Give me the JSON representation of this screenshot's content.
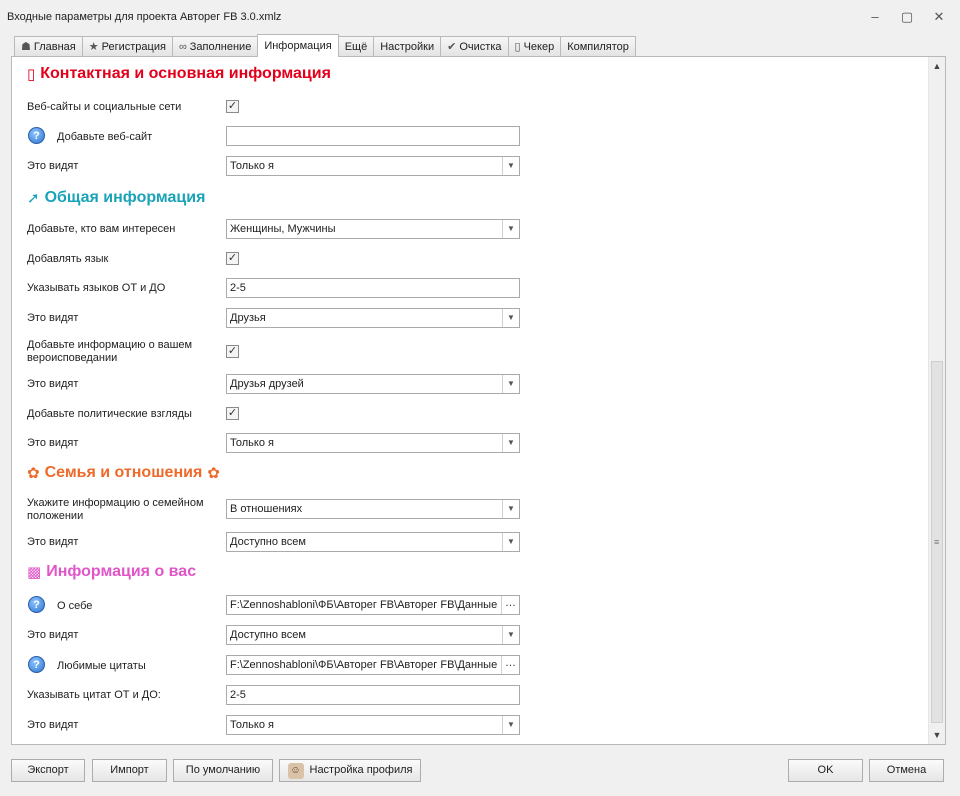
{
  "window": {
    "title": "Входные параметры для проекта Автoрег FB 3.0.xmlz",
    "controls": {
      "minimize": "–",
      "maximize": "▢",
      "close": "✕"
    }
  },
  "tabs": [
    {
      "label": "Главная",
      "icon": "☗"
    },
    {
      "label": "Регистрация",
      "icon": "★"
    },
    {
      "label": "Заполнение",
      "icon": "∞"
    },
    {
      "label": "Информация",
      "icon": ""
    },
    {
      "label": "Ещё",
      "icon": ""
    },
    {
      "label": "Настройки",
      "icon": ""
    },
    {
      "label": "Очистка",
      "icon": "✔"
    },
    {
      "label": "Чекер",
      "icon": "▯"
    },
    {
      "label": "Компилятор",
      "icon": ""
    }
  ],
  "active_tab": "Информация",
  "colors": {
    "contact": "#e3001b",
    "general": "#1aa3b8",
    "family": "#ee6a2a",
    "about": "#e055c8"
  },
  "sections": {
    "contact": {
      "title": "Контактная и основная информация",
      "icon": "contact-icon",
      "websites_label": "Веб-сайты и социальные сети",
      "websites_checked": true,
      "add_website_label": "Добавьте веб-сайт",
      "add_website_value": "",
      "visibility_label": "Это видят",
      "visibility_value": "Только я"
    },
    "general": {
      "title": "Общая информация",
      "icon": "general-icon",
      "interested_label": "Добавьте, кто вам интересен",
      "interested_value": "Женщины, Мужчины",
      "add_lang_label": "Добавлять язык",
      "add_lang_checked": true,
      "lang_range_label": "Указывать языков ОТ и ДО",
      "lang_range_value": "2-5",
      "vis1_label": "Это видят",
      "vis1_value": "Друзья",
      "religion_label": "Добавьте информацию о вашем вероисповедании",
      "religion_checked": true,
      "vis2_label": "Это видят",
      "vis2_value": "Друзья друзей",
      "politics_label": "Добавьте политические взгляды",
      "politics_checked": true,
      "vis3_label": "Это видят",
      "vis3_value": "Только я"
    },
    "family": {
      "title": "Семья и отношения",
      "icon": "family-icon",
      "status_label": "Укажите информацию о семейном положении",
      "status_value": "В отношениях",
      "vis_label": "Это видят",
      "vis_value": "Доступно всем"
    },
    "about": {
      "title": "Информация о вас",
      "icon": "about-icon",
      "about_label": "О себе",
      "about_value": "F:\\Zennoshabloni\\ФБ\\Авторег FB\\Авторег FB\\Данные",
      "vis1_label": "Это видят",
      "vis1_value": "Доступно всем",
      "quotes_label": "Любимые цитаты",
      "quotes_value": "F:\\Zennoshabloni\\ФБ\\Авторег FB\\Авторег FB\\Данные",
      "quotes_range_label": "Указывать цитат ОТ и ДО:",
      "quotes_range_value": "2-5",
      "vis2_label": "Это видят",
      "vis2_value": "Только я"
    }
  },
  "footer": {
    "export": "Экспорт",
    "import": "Импорт",
    "default": "По умолчанию",
    "profile": "Настройка профиля",
    "ok": "OK",
    "cancel": "Отмена"
  }
}
